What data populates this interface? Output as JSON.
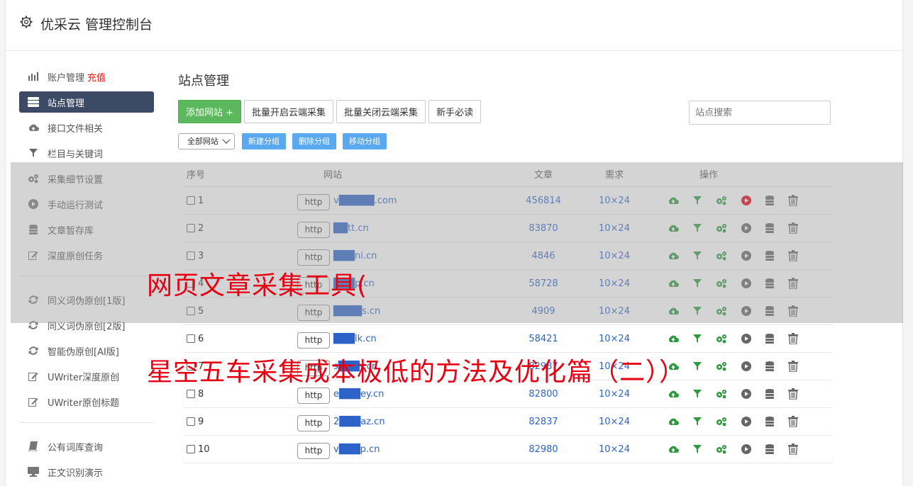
{
  "header": {
    "title": "优采云 管理控制台"
  },
  "sidebar": {
    "group1": [
      {
        "label": "账户管理",
        "badge": "充值",
        "icon": "bar-chart-icon"
      },
      {
        "label": "站点管理",
        "icon": "server-icon",
        "active": true
      },
      {
        "label": "接口文件相关",
        "icon": "cloud-upload-icon"
      },
      {
        "label": "栏目与关键词",
        "icon": "filter-icon"
      },
      {
        "label": "采集细节设置",
        "icon": "gears-icon"
      },
      {
        "label": "手动运行测试",
        "icon": "play-icon"
      },
      {
        "label": "文章暂存库",
        "icon": "database-icon"
      },
      {
        "label": "深度原创任务",
        "icon": "edit-icon"
      }
    ],
    "group2": [
      {
        "label": "同义词伪原创[1版]",
        "icon": "refresh-icon"
      },
      {
        "label": "同义词伪原创[2版]",
        "icon": "refresh-icon"
      },
      {
        "label": "智能伪原创[AI版]",
        "icon": "refresh-icon"
      },
      {
        "label": "UWriter深度原创",
        "icon": "edit-icon"
      },
      {
        "label": "UWriter原创标题",
        "icon": "edit-icon"
      }
    ],
    "group3": [
      {
        "label": "公有词库查询",
        "icon": "book-icon"
      },
      {
        "label": "正文识别演示",
        "icon": "monitor-icon"
      }
    ]
  },
  "main": {
    "title": "站点管理",
    "buttons": {
      "add": "添加网站 +",
      "batch_on": "批量开启云端采集",
      "batch_off": "批量关闭云端采集",
      "guide": "新手必读"
    },
    "search_placeholder": "站点搜索",
    "group_select": "全部网站",
    "group_buttons": {
      "new": "新建分组",
      "delete": "删除分组",
      "move": "移动分组"
    },
    "table": {
      "headers": {
        "no": "序号",
        "site": "网站",
        "articles": "文章",
        "demand": "需求",
        "ops": "操作"
      },
      "http_label": "http",
      "rows": [
        {
          "no": "1",
          "site": "v█████.com",
          "articles": "456814",
          "demand": "10×24",
          "running": true
        },
        {
          "no": "2",
          "site": "██tt.cn",
          "articles": "83870",
          "demand": "10×24"
        },
        {
          "no": "3",
          "site": "███ni.cn",
          "articles": "4846",
          "demand": "10×24"
        },
        {
          "no": "4",
          "site": "███p.cn",
          "articles": "58728",
          "demand": "10×24"
        },
        {
          "no": "5",
          "site": "████s.cn",
          "articles": "4909",
          "demand": "10×24"
        },
        {
          "no": "6",
          "site": "███lk.cn",
          "articles": "58421",
          "demand": "10×24"
        },
        {
          "no": "7",
          "site": "s███y.cn",
          "articles": "82987",
          "demand": "10×24"
        },
        {
          "no": "8",
          "site": "e███ey.cn",
          "articles": "82800",
          "demand": "10×24"
        },
        {
          "no": "9",
          "site": "2███az.cn",
          "articles": "82837",
          "demand": "10×24"
        },
        {
          "no": "10",
          "site": "v███p.cn",
          "articles": "82980",
          "demand": "10×24"
        }
      ]
    }
  },
  "overlay": {
    "line1": "网页文章采集工具(",
    "line2": "星空五车采集成本极低的方法及优化篇（二））"
  },
  "colors": {
    "accent_green": "#5cb85c",
    "sidebar_active": "#3d4a66",
    "link_blue": "#2d63c8",
    "overlay_red": "#e60012",
    "small_button_blue": "#5aa9f0"
  }
}
